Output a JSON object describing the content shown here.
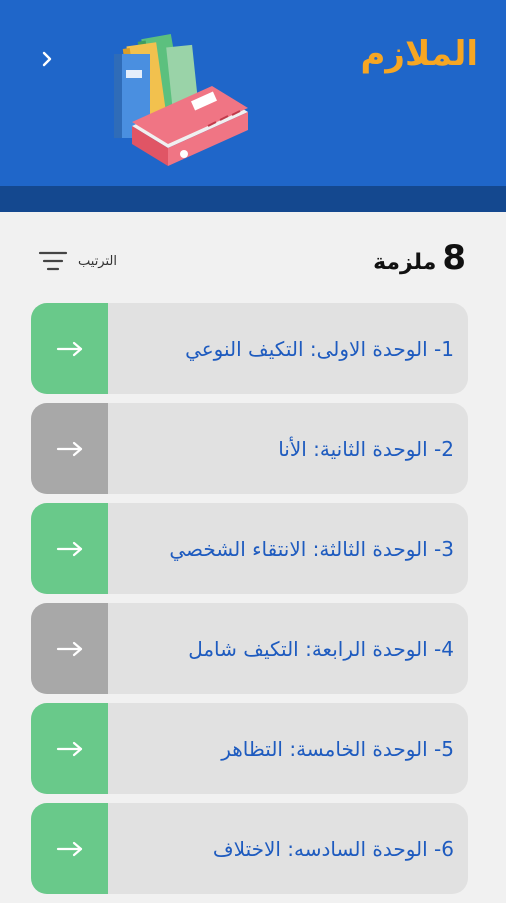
{
  "header": {
    "title": "الملازم"
  },
  "summary": {
    "count": "8",
    "count_label": "ملزمة"
  },
  "sort": {
    "label": "الترتيب"
  },
  "items": [
    {
      "label": "1- الوحدة الاولى: التكيف النوعي",
      "status_color": "green"
    },
    {
      "label": "2-  الوحدة الثانية: الأنا",
      "status_color": "gray"
    },
    {
      "label": "3- الوحدة الثالثة: الانتقاء الشخصي",
      "status_color": "green"
    },
    {
      "label": "4- الوحدة الرابعة: التكيف شامل",
      "status_color": "gray"
    },
    {
      "label": "5- الوحدة الخامسة: التظاهر",
      "status_color": "green"
    },
    {
      "label": "6- الوحدة السادسه: الاختلاف",
      "status_color": "green"
    }
  ],
  "colors": {
    "header_bg": "#1f66c9",
    "header_band": "#14488f",
    "title": "#f6a623",
    "item_label": "#1e5bbf",
    "green": "#69c98a",
    "gray": "#a8a8a8"
  }
}
